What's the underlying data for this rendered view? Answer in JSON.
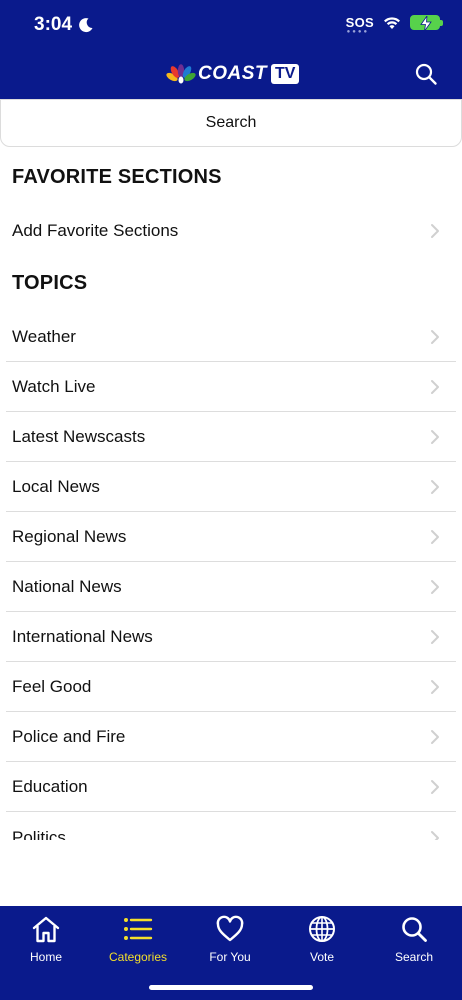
{
  "status_bar": {
    "time": "3:04",
    "sos": "SOS"
  },
  "header": {
    "logo_word": "COAST",
    "logo_tv": "TV",
    "search_icon": "search-icon",
    "accent_color": "#0a1a8c"
  },
  "search": {
    "label": "Search"
  },
  "favorite_sections": {
    "title": "FAVORITE SECTIONS",
    "add_label": "Add Favorite Sections"
  },
  "topics": {
    "title": "TOPICS",
    "items": [
      {
        "label": "Weather"
      },
      {
        "label": "Watch Live"
      },
      {
        "label": "Latest Newscasts"
      },
      {
        "label": "Local News"
      },
      {
        "label": "Regional News"
      },
      {
        "label": "National News"
      },
      {
        "label": "International News"
      },
      {
        "label": "Feel Good"
      },
      {
        "label": "Police and Fire"
      },
      {
        "label": "Education"
      },
      {
        "label": "Politics"
      }
    ]
  },
  "tabbar": {
    "active_color": "#f4df2b",
    "tabs": [
      {
        "label": "Home",
        "icon": "home-icon"
      },
      {
        "label": "Categories",
        "icon": "list-icon",
        "active": true
      },
      {
        "label": "For You",
        "icon": "heart-icon"
      },
      {
        "label": "Vote",
        "icon": "globe-icon"
      },
      {
        "label": "Search",
        "icon": "search-icon"
      }
    ]
  }
}
